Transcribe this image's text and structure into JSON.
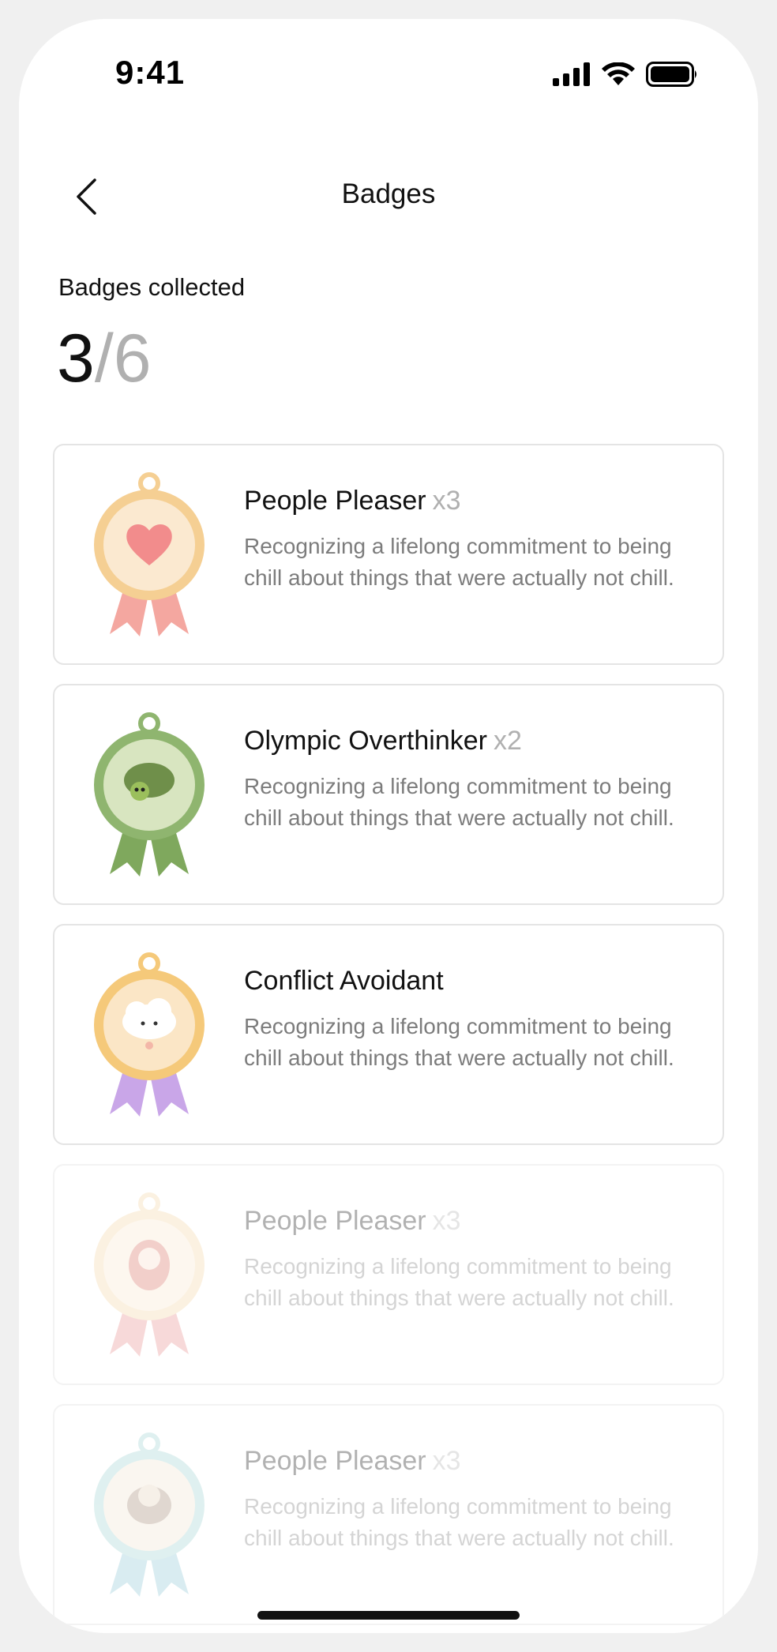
{
  "status_bar": {
    "time": "9:41"
  },
  "nav": {
    "title": "Badges",
    "back_icon": "chevron-left-icon"
  },
  "summary": {
    "label": "Badges collected",
    "collected": "3",
    "total": "/6"
  },
  "badges": [
    {
      "title": "People Pleaser",
      "multiplier": "x3",
      "description": "Recognizing a lifelong commitment to being chill about things that were actually not chill.",
      "locked": false,
      "icon": "heart-medal-icon",
      "colors": {
        "rim": "#f5cf93",
        "face": "#fbe9d0",
        "ribbon": "#f4a7a0",
        "motif": "#f28c8c"
      }
    },
    {
      "title": "Olympic Overthinker",
      "multiplier": "x2",
      "description": "Recognizing a lifelong commitment to being chill about things that were actually not chill.",
      "locked": false,
      "icon": "turtle-medal-icon",
      "colors": {
        "rim": "#8fb56f",
        "face": "#d8e5c0",
        "ribbon": "#7fa85d",
        "motif": "#6f8f4a"
      }
    },
    {
      "title": "Conflict Avoidant",
      "multiplier": "",
      "description": "Recognizing a lifelong commitment to being chill about things that were actually not chill.",
      "locked": false,
      "icon": "cloud-medal-icon",
      "colors": {
        "rim": "#f5c97a",
        "face": "#fbe6c6",
        "ribbon": "#c9a6e8",
        "motif": "#f3b7a8"
      }
    },
    {
      "title": "People Pleaser",
      "multiplier": "x3",
      "description": "Recognizing a lifelong commitment to being chill about things that were actually not chill.",
      "locked": true,
      "icon": "girl-medal-icon",
      "colors": {
        "rim": "#f5d5a3",
        "face": "#fbe9d0",
        "ribbon": "#e88a8a",
        "motif": "#d96b5e"
      }
    },
    {
      "title": "People Pleaser",
      "multiplier": "x3",
      "description": "Recognizing a lifelong commitment to being chill about things that were actually not chill.",
      "locked": true,
      "icon": "sloth-medal-icon",
      "colors": {
        "rim": "#9fd3d1",
        "face": "#f2e5d3",
        "ribbon": "#8cc7d4",
        "motif": "#a08670"
      }
    }
  ]
}
